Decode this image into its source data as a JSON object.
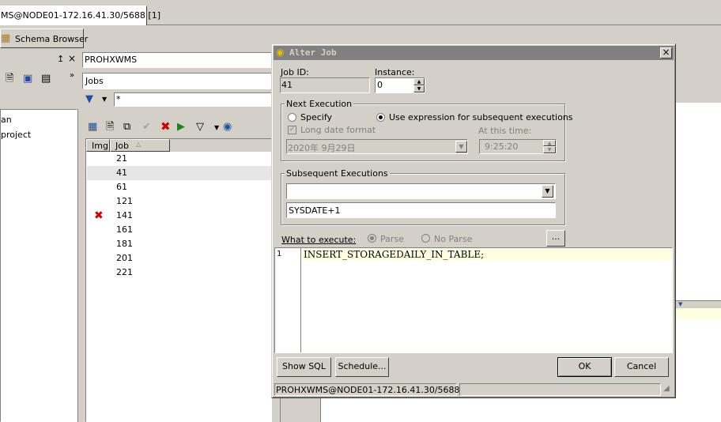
{
  "tab_title": "MS@NODE01-172.16.41.30/5688 [1]",
  "schema_browser": {
    "title": "Schema Browser",
    "schema": "PROHXWMS",
    "object_type": "Jobs",
    "filter": "*",
    "left_items": [
      "an",
      "project"
    ],
    "columns": {
      "img": "Img",
      "job": "Job"
    },
    "jobs": [
      {
        "id": "21",
        "error": false
      },
      {
        "id": "41",
        "error": false,
        "selected": true
      },
      {
        "id": "61",
        "error": false
      },
      {
        "id": "121",
        "error": false
      },
      {
        "id": "141",
        "error": true
      },
      {
        "id": "161",
        "error": false
      },
      {
        "id": "181",
        "error": false
      },
      {
        "id": "201",
        "error": false
      },
      {
        "id": "221",
        "error": false
      }
    ]
  },
  "dialog": {
    "title": "Alter Job",
    "job_id_label": "Job ID:",
    "job_id": "41",
    "instance_label": "Instance:",
    "instance": "0",
    "next_execution": {
      "title": "Next Execution",
      "specify_label": "Specify",
      "use_expression_label": "Use expression for subsequent executions",
      "selected": "use_expression",
      "long_date_label": "Long date format",
      "date_value": "2020年  9月29日",
      "at_this_time_label": "At this time:",
      "time_value": "9:25:20"
    },
    "subsequent": {
      "title": "Subsequent Executions",
      "dropdown_value": "",
      "expression": "SYSDATE+1"
    },
    "what_to_execute": {
      "label": "What to execute:",
      "parse_label": "Parse",
      "no_parse_label": "No Parse",
      "more_label": "...",
      "line_number": "1",
      "code": "INSERT_STORAGEDAILY_IN_TABLE;"
    },
    "buttons": {
      "show_sql": "Show SQL",
      "schedule": "Schedule...",
      "ok": "OK",
      "cancel": "Cancel"
    },
    "status": "PROHXWMS@NODE01-172.16.41.30/5688"
  },
  "colors": {
    "face": "#d4d0c8",
    "title_bar": "#808080",
    "selected_row": "#e6e6e6",
    "code_highlight": "#ffffe1",
    "error_icon": "#cc0000"
  }
}
